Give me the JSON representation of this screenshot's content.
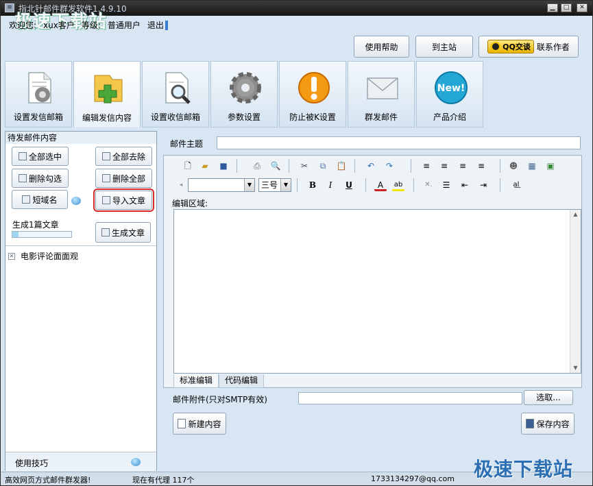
{
  "window": {
    "title": "指北针邮件群发软件1.4.9.10",
    "watermark": "极速下载站",
    "controls": {
      "minimize": "▁",
      "maximize": "□",
      "close": "✕"
    }
  },
  "welcome": {
    "greeting": "欢迎您:",
    "user": "xux客户",
    "level_label": "等级:",
    "level": "普通用户",
    "logout": "退出"
  },
  "top_buttons": {
    "help": "使用帮助",
    "home": "到主站",
    "qq_badge": "QQ交谈",
    "contact": "联系作者"
  },
  "tabs": [
    {
      "label": "设置发信邮箱",
      "icon": "doc-gear-icon"
    },
    {
      "label": "编辑发信内容",
      "icon": "folder-plus-icon"
    },
    {
      "label": "设置收信邮箱",
      "icon": "doc-magnifier-icon"
    },
    {
      "label": "参数设置",
      "icon": "gear-icon"
    },
    {
      "label": "防止被K设置",
      "icon": "warning-icon"
    },
    {
      "label": "群发邮件",
      "icon": "envelope-icon"
    },
    {
      "label": "产品介绍",
      "icon": "new-badge-icon",
      "badge": "New!"
    }
  ],
  "left_panel": {
    "header": "待发邮件内容",
    "buttons": {
      "select_all": "全部选中",
      "remove_all": "全部去除",
      "delete_checked": "删除勾选",
      "delete_all": "删除全部",
      "short_domain": "短域名",
      "import_article": "导入文章",
      "generate_article": "生成文章"
    },
    "generate_label": "生成1篇文章",
    "generate_progress": 0.1,
    "list_items": [
      "电影评论面面观"
    ],
    "tips": "使用技巧"
  },
  "editor": {
    "subject_label": "邮件主题",
    "subject_value": "",
    "font_select": "",
    "size_select": "三号",
    "edit_area_label": "编辑区域:",
    "tabs": [
      "标准编辑",
      "代码编辑"
    ],
    "attachment_label": "邮件附件(只对SMTP有效)",
    "attachment_value": "",
    "choose_button": "选取...",
    "new_button": "新建内容",
    "save_button": "保存内容"
  },
  "status_bar": {
    "slogan": "高效网页方式邮件群发器!",
    "proxy": "现在有代理 117个",
    "email": "1733134297@qq.com"
  }
}
